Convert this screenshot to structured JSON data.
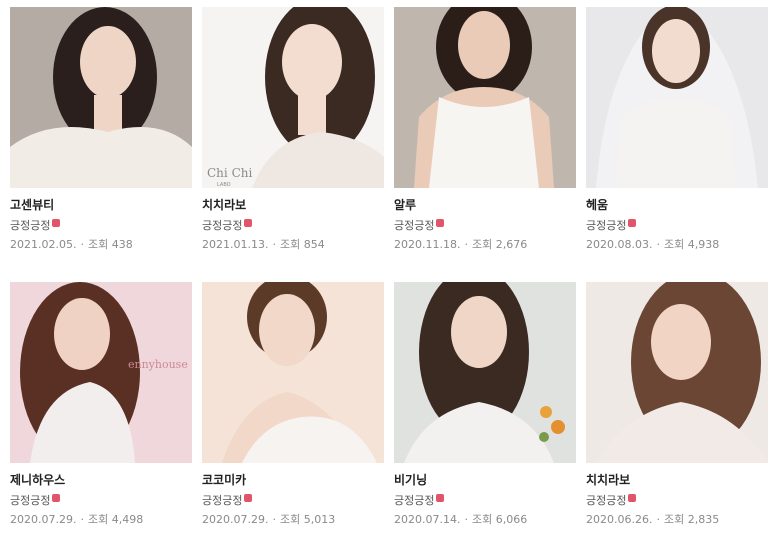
{
  "posts": [
    {
      "title": "고센뷰티",
      "author": "긍정긍정",
      "date": "2021.02.05.",
      "views_label": "조회",
      "views": "438",
      "colors": {
        "bg": "#b4aca4",
        "hair": "#2a1f1c",
        "skin": "#eed5c6",
        "dress": "#f1ece6"
      }
    },
    {
      "title": "치치라보",
      "author": "긍정긍정",
      "date": "2021.01.13.",
      "views_label": "조회",
      "views": "854",
      "colors": {
        "bg": "#f6f4f2",
        "hair": "#3b2a22",
        "skin": "#f3dcd0",
        "dress": "#efe7e1"
      },
      "overlay_line1": "Chi Chi",
      "overlay_line2": "LABO"
    },
    {
      "title": "알루",
      "author": "긍정긍정",
      "date": "2020.11.18.",
      "views_label": "조회",
      "views": "2,676",
      "colors": {
        "bg": "#bfb7ae",
        "hair": "#2b1e19",
        "skin": "#e9cbb8",
        "dress": "#f7f5f2"
      }
    },
    {
      "title": "헤움",
      "author": "긍정긍정",
      "date": "2020.08.03.",
      "views_label": "조회",
      "views": "4,938",
      "colors": {
        "bg": "#e8e8ea",
        "hair": "#4a3328",
        "skin": "#f2dccf",
        "dress": "#f5f3f2"
      }
    },
    {
      "title": "제니하우스",
      "author": "긍정긍정",
      "date": "2020.07.29.",
      "views_label": "조회",
      "views": "4,498",
      "colors": {
        "bg": "#f0d7db",
        "hair": "#5a3024",
        "skin": "#efd2c4",
        "dress": "#f2eeee"
      },
      "overlay_line1": "ennyhouse",
      "overlay_line2": ""
    },
    {
      "title": "코코미카",
      "author": "긍정긍정",
      "date": "2020.07.29.",
      "views_label": "조회",
      "views": "5,013",
      "colors": {
        "bg": "#f4e3d6",
        "hair": "#5c3a28",
        "skin": "#f1d8c8",
        "dress": "#f7f3f0"
      }
    },
    {
      "title": "비기닝",
      "author": "긍정긍정",
      "date": "2020.07.14.",
      "views_label": "조회",
      "views": "6,066",
      "colors": {
        "bg": "#dfe2df",
        "hair": "#3a2a22",
        "skin": "#efd6c7",
        "dress": "#f3f1ef"
      }
    },
    {
      "title": "치치라보",
      "author": "긍정긍정",
      "date": "2020.06.26.",
      "views_label": "조회",
      "views": "2,835",
      "colors": {
        "bg": "#efe9e5",
        "hair": "#6b4634",
        "skin": "#f1d4c3",
        "dress": "#f2eae6"
      }
    }
  ],
  "accent": {
    "new_badge": "#e0556a",
    "meta_text": "#8a8a8a"
  }
}
